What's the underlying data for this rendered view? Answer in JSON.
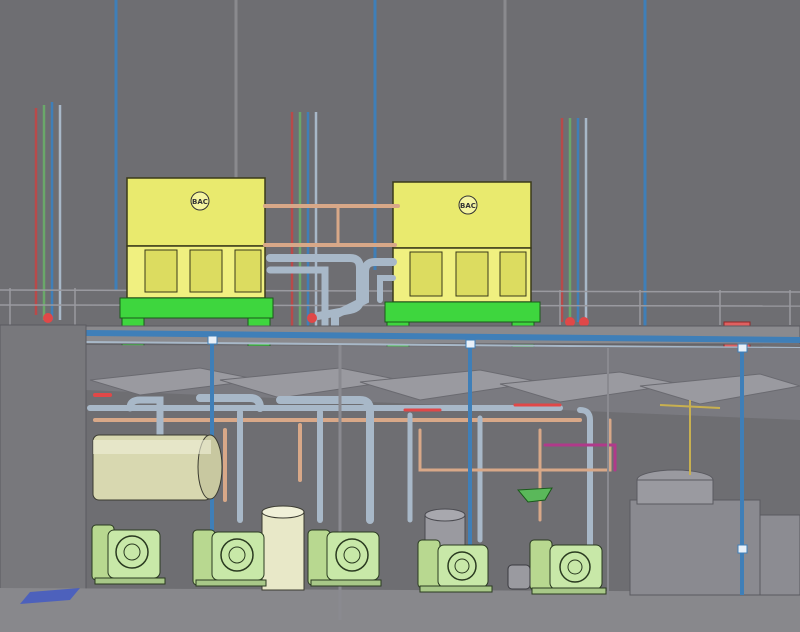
{
  "scene": {
    "background": "#6e6e72",
    "wall": "#77777b",
    "mezzanine": "#8a8a8e",
    "floor": "#88888c"
  },
  "colors": {
    "condenser_body": "#e9ea6e",
    "condenser_outline": "#3a3a1a",
    "condenser_base": "#3ed63e",
    "pipe_blue": "#3f7fb8",
    "pipe_steel": "#a8b8c8",
    "pipe_copper": "#d8a888",
    "pipe_red": "#b84a4a",
    "pipe_green": "#6aa86a",
    "pipe_magenta": "#b03a8a",
    "receiver_tank": "#d8d8b0",
    "compressor": "#c8e8a8",
    "compressor_motor": "#b8d890",
    "accent_red": "#e04848"
  },
  "equipment": {
    "condensers": [
      {
        "id": "condenser-1",
        "logo": "BAC"
      },
      {
        "id": "condenser-2",
        "logo": "BAC"
      }
    ],
    "compressors": [
      {
        "id": "compressor-1"
      },
      {
        "id": "compressor-2"
      },
      {
        "id": "compressor-3"
      },
      {
        "id": "compressor-4"
      },
      {
        "id": "compressor-5"
      }
    ],
    "receiver": {
      "id": "horizontal-receiver"
    },
    "vessels": [
      {
        "id": "vertical-vessel-1"
      },
      {
        "id": "vertical-vessel-2"
      },
      {
        "id": "domed-tank"
      }
    ]
  }
}
